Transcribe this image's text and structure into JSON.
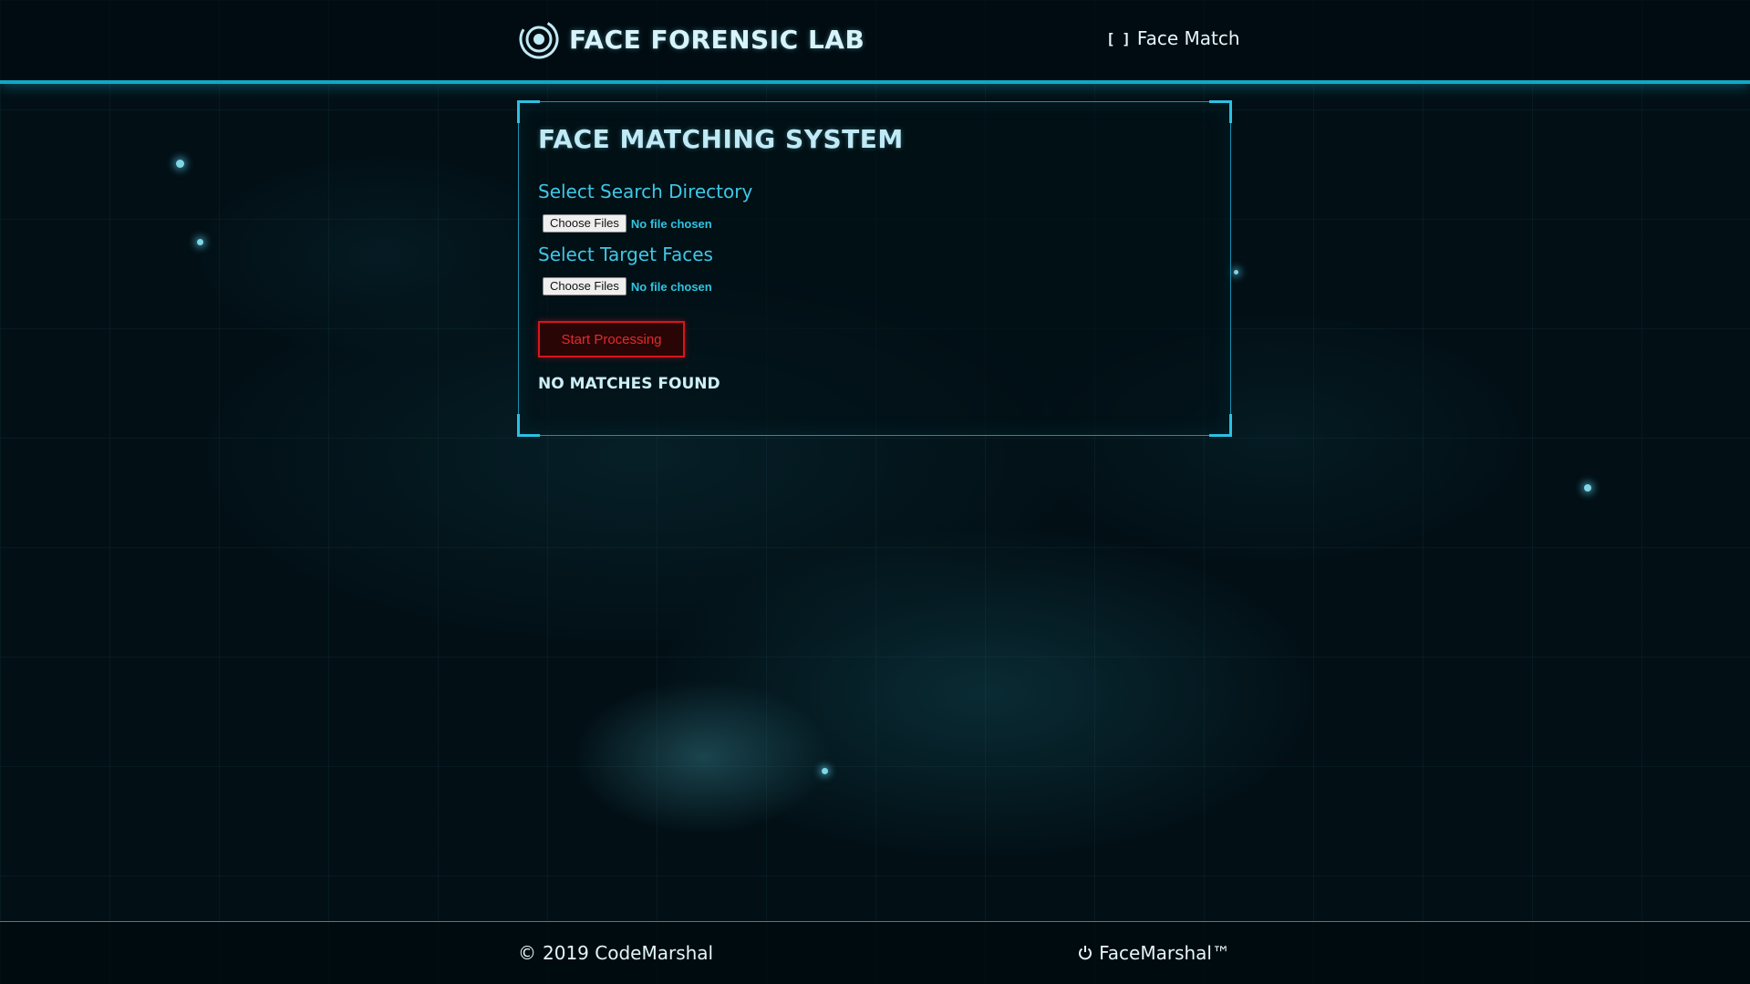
{
  "header": {
    "brand": "FACE FORENSIC LAB",
    "brand_icon": "target-icon",
    "nav_link_icon": "bracket-icon",
    "nav_link": "Face Match"
  },
  "panel": {
    "title": "FACE MATCHING SYSTEM",
    "search_directory": {
      "label": "Select Search Directory",
      "button": "Choose Files",
      "status": "No file chosen"
    },
    "target_faces": {
      "label": "Select Target Faces",
      "button": "Choose Files",
      "status": "No file chosen"
    },
    "start_button": "Start Processing",
    "result": "NO MATCHES FOUND"
  },
  "footer": {
    "copyright_icon": "copyright-icon",
    "copyright": "2019 CodeMarshal",
    "product_icon": "power-icon",
    "product": "FaceMarshal™"
  },
  "colors": {
    "accent": "#12a8c8",
    "label": "#3fc7e6",
    "danger": "#d8161b",
    "background": "#021016"
  }
}
